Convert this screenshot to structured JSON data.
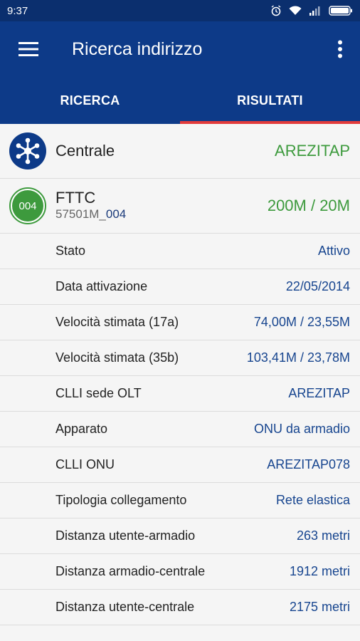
{
  "status_bar": {
    "time": "9:37"
  },
  "app_bar": {
    "title": "Ricerca indirizzo"
  },
  "tabs": [
    {
      "label": "RICERCA",
      "active": false
    },
    {
      "label": "RISULTATI",
      "active": true
    }
  ],
  "centrale": {
    "label": "Centrale",
    "value": "AREZITAP"
  },
  "fttc": {
    "badge": "004",
    "title": "FTTC",
    "sub_prefix": "57501M_",
    "sub_highlight": "004",
    "value": "200M / 20M"
  },
  "details": [
    {
      "key": "Stato",
      "value": "Attivo"
    },
    {
      "key": "Data attivazione",
      "value": "22/05/2014"
    },
    {
      "key": "Velocità stimata (17a)",
      "value": "74,00M / 23,55M"
    },
    {
      "key": "Velocità stimata (35b)",
      "value": "103,41M / 23,78M"
    },
    {
      "key": "CLLI sede OLT",
      "value": "AREZITAP"
    },
    {
      "key": "Apparato",
      "value": "ONU da armadio"
    },
    {
      "key": "CLLI ONU",
      "value": "AREZITAP078"
    },
    {
      "key": "Tipologia collegamento",
      "value": "Rete elastica"
    },
    {
      "key": "Distanza utente-armadio",
      "value": "263 metri"
    },
    {
      "key": "Distanza armadio-centrale",
      "value": "1912 metri"
    },
    {
      "key": "Distanza utente-centrale",
      "value": "2175 metri"
    }
  ],
  "colors": {
    "primary": "#0d3a88",
    "accent": "#e23b3b",
    "green": "#3d9a3d",
    "value_blue": "#17458f"
  }
}
